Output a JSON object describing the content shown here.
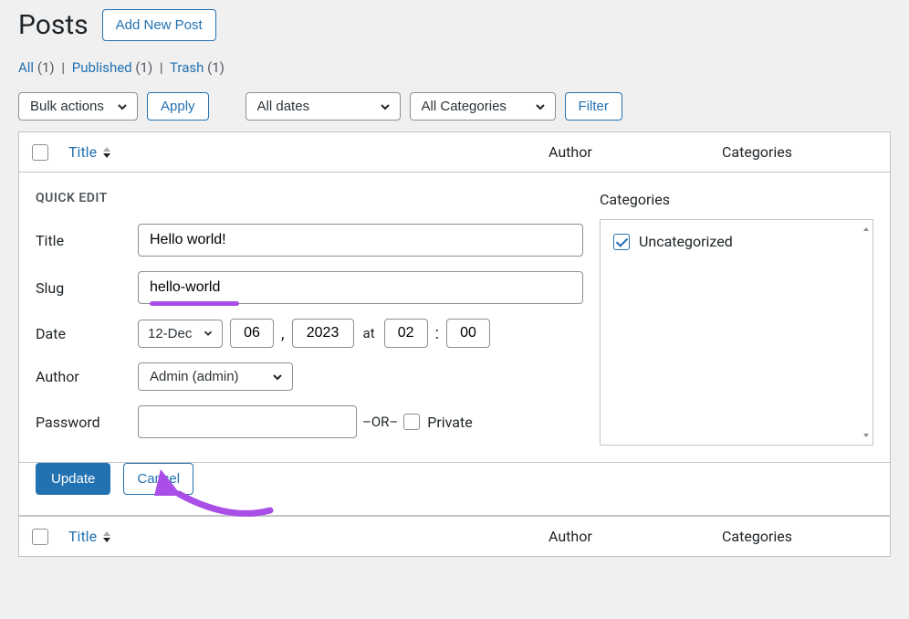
{
  "header": {
    "title": "Posts",
    "add_new_label": "Add New Post"
  },
  "filters": {
    "all_label": "All",
    "all_count": "(1)",
    "published_label": "Published",
    "published_count": "(1)",
    "trash_label": "Trash",
    "trash_count": "(1)"
  },
  "actions": {
    "bulk_label": "Bulk actions",
    "apply_label": "Apply",
    "dates_label": "All dates",
    "cats_label": "All Categories",
    "filter_label": "Filter"
  },
  "columns": {
    "title": "Title",
    "author": "Author",
    "categories": "Categories"
  },
  "quick_edit": {
    "heading": "QUICK EDIT",
    "title_label": "Title",
    "title_value": "Hello world!",
    "slug_label": "Slug",
    "slug_value": "hello-world",
    "date_label": "Date",
    "month_value": "12-Dec",
    "day_value": "06",
    "year_value": "2023",
    "at_label": "at",
    "hour_value": "02",
    "minute_value": "00",
    "author_label": "Author",
    "author_value": "Admin (admin)",
    "password_label": "Password",
    "or_label": "–OR–",
    "private_label": "Private",
    "categories_label": "Categories",
    "category_item": "Uncategorized",
    "update_label": "Update",
    "cancel_label": "Cancel"
  }
}
